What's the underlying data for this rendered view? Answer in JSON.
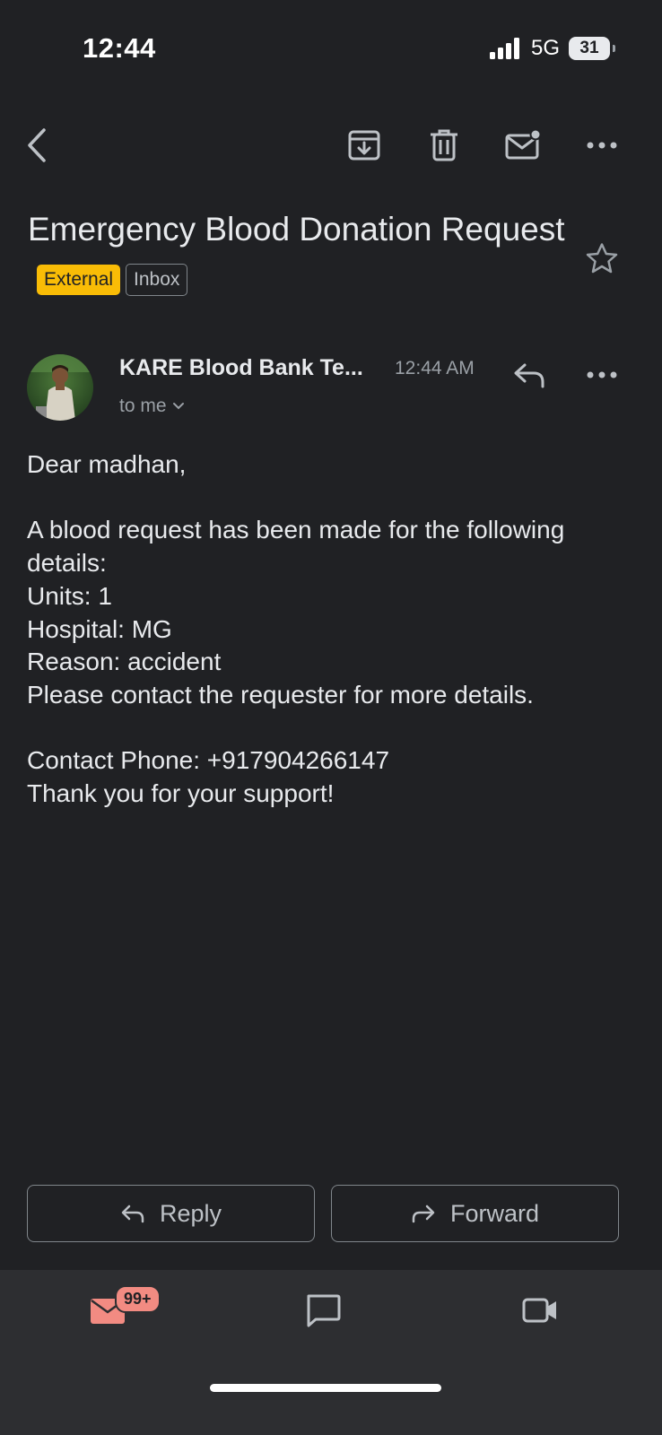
{
  "status_bar": {
    "time": "12:44",
    "network": "5G",
    "battery": "31"
  },
  "toolbar": {
    "back_icon": "chevron-left-icon",
    "archive_icon": "archive-icon",
    "delete_icon": "trash-icon",
    "mark_unread_icon": "mail-unread-icon",
    "more_icon": "more-horizontal-icon"
  },
  "email": {
    "subject": "Emergency Blood Donation Request",
    "label_external": "External",
    "label_inbox": "Inbox",
    "sender": "KARE Blood Bank Te...",
    "time": "12:44 AM",
    "recipient": "to me",
    "body": [
      "Dear madhan,",
      "",
      "A blood request has been made for the following details:",
      "Units: 1",
      "Hospital: MG",
      "Reason: accident",
      "Please contact the requester for more details.",
      "",
      "Contact Phone: +917904266147",
      "Thank you for your support!"
    ]
  },
  "actions": {
    "reply_label": "Reply",
    "forward_label": "Forward"
  },
  "bottom_nav": {
    "mail_badge": "99+"
  },
  "colors": {
    "background": "#202124",
    "badge_external": "#f9bc06",
    "mail_accent": "#f28b82"
  }
}
